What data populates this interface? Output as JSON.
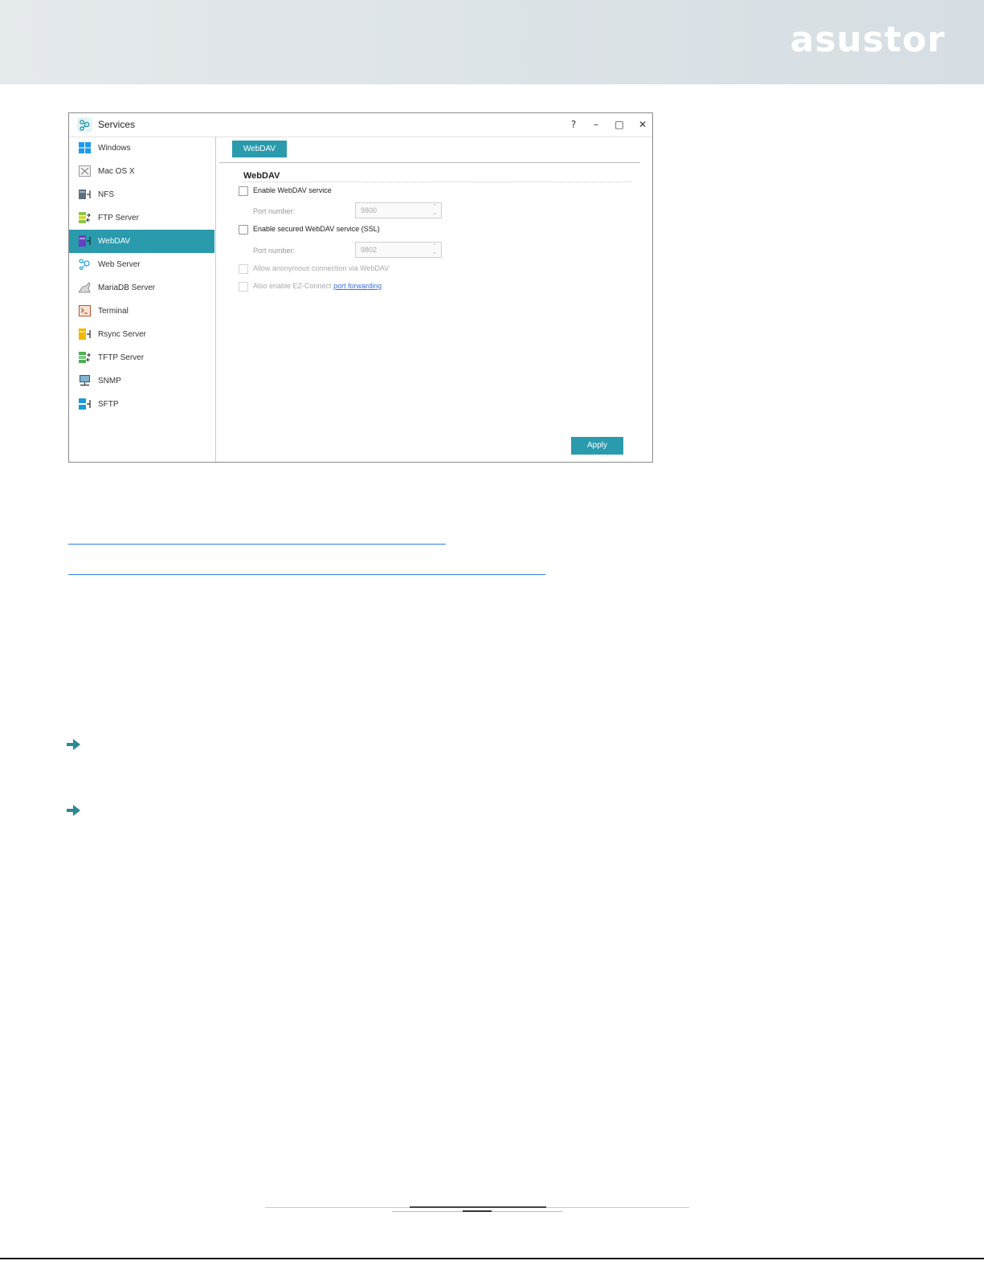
{
  "header": {
    "logo": "asustor"
  },
  "window": {
    "title": "Services",
    "controls": {
      "help": "?",
      "minimize": "–",
      "maximize": "□",
      "close": "✕"
    }
  },
  "sidebar": {
    "items": [
      {
        "label": "Windows",
        "icon": "windows-icon",
        "color": "#1b9bf0"
      },
      {
        "label": "Mac OS X",
        "icon": "mac-os-x-icon",
        "color": "#9a9a9a"
      },
      {
        "label": "NFS",
        "icon": "nfs-icon",
        "color": "#5b6f7f"
      },
      {
        "label": "FTP Server",
        "icon": "ftp-server-icon",
        "color": "#8bc34a"
      },
      {
        "label": "WebDAV",
        "icon": "webdav-icon",
        "color": "#6a3fc4",
        "active": true
      },
      {
        "label": "Web Server",
        "icon": "web-server-icon",
        "color": "#29a9e0"
      },
      {
        "label": "MariaDB Server",
        "icon": "mariadb-server-icon",
        "color": "#777777"
      },
      {
        "label": "Terminal",
        "icon": "terminal-icon",
        "color": "#c0522a"
      },
      {
        "label": "Rsync Server",
        "icon": "rsync-server-icon",
        "color": "#f2b705"
      },
      {
        "label": "TFTP Server",
        "icon": "tftp-server-icon",
        "color": "#4caf50"
      },
      {
        "label": "SNMP",
        "icon": "snmp-icon",
        "color": "#2a5a7a"
      },
      {
        "label": "SFTP",
        "icon": "sftp-icon",
        "color": "#1b9bd8"
      }
    ]
  },
  "main": {
    "tab": "WebDAV",
    "section_title": "WebDAV",
    "enable_webdav": {
      "label": "Enable WebDAV service",
      "checked": false
    },
    "port1": {
      "label": "Port number:",
      "value": "9800"
    },
    "enable_ssl": {
      "label": "Enable secured WebDAV service (SSL)",
      "checked": false
    },
    "port2": {
      "label": "Port number:",
      "value": "9802"
    },
    "anonymous": {
      "label": "Allow anonymous connection via WebDAV",
      "checked": false
    },
    "ezconnect": {
      "label": "Also enable EZ-Connect ",
      "link": "port forwarding",
      "checked": false
    },
    "apply": "Apply"
  },
  "colors": {
    "accent": "#2a9aad",
    "link": "#3a6fe0"
  }
}
